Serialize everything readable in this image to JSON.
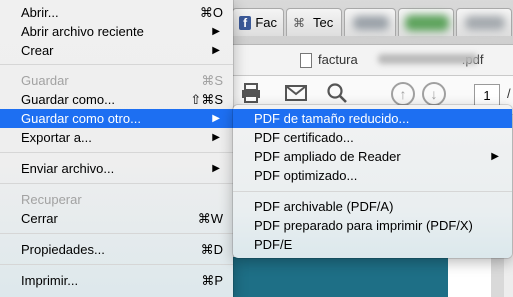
{
  "browser": {
    "tabs": [
      {
        "label": "Fac",
        "icon": "facebook-icon"
      },
      {
        "label": "Tec",
        "icon": "tec-icon"
      }
    ],
    "document_title_prefix": "factura",
    "document_title_suffix": ".pdf",
    "page_number": "1",
    "page_separator": "/"
  },
  "main_menu": {
    "items": [
      {
        "label": "Abrir...",
        "shortcut": "⌘O"
      },
      {
        "label": "Abrir archivo reciente",
        "submenu": "▶"
      },
      {
        "label": "Crear",
        "submenu": "▶"
      },
      {
        "label": "Guardar",
        "shortcut": "⌘S",
        "disabled": true
      },
      {
        "label": "Guardar como...",
        "shortcut": "⇧⌘S"
      },
      {
        "label": "Guardar como otro...",
        "submenu": "▶",
        "highlighted": true
      },
      {
        "label": "Exportar a...",
        "submenu": "▶"
      },
      {
        "label": "Enviar archivo...",
        "submenu": "▶"
      },
      {
        "label": "Recuperar",
        "disabled": true
      },
      {
        "label": "Cerrar",
        "shortcut": "⌘W"
      },
      {
        "label": "Propiedades...",
        "shortcut": "⌘D"
      },
      {
        "label": "Imprimir...",
        "shortcut": "⌘P"
      }
    ]
  },
  "submenu": {
    "items": [
      {
        "label": "PDF de tamaño reducido...",
        "highlighted": true
      },
      {
        "label": "PDF certificado..."
      },
      {
        "label": "PDF ampliado de Reader",
        "submenu": "▶"
      },
      {
        "label": "PDF optimizado..."
      },
      {
        "label": "PDF archivable (PDF/A)"
      },
      {
        "label": "PDF preparado para imprimir (PDF/X)"
      },
      {
        "label": "PDF/E"
      }
    ]
  },
  "colors": {
    "highlight": "#1d6ff2",
    "disabled_text": "#a2a2a2",
    "document_band": "#1e6f86",
    "facebook_blue": "#3b5998"
  }
}
